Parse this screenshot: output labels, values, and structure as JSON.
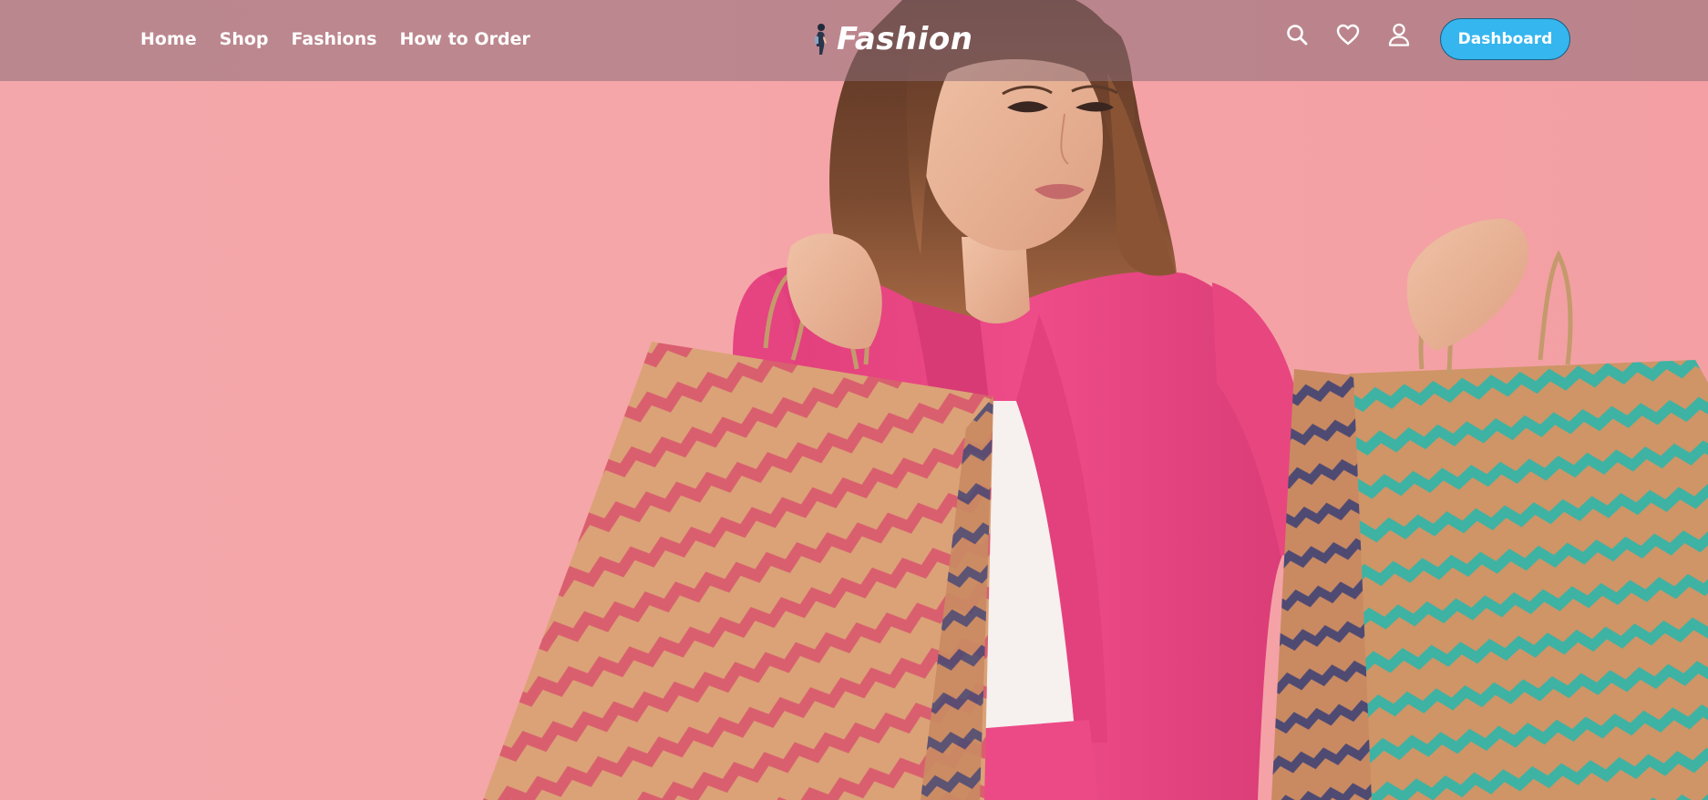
{
  "navbar": {
    "links": [
      {
        "label": "Home"
      },
      {
        "label": "Shop"
      },
      {
        "label": "Fashions"
      },
      {
        "label": "How to Order"
      }
    ],
    "brand": {
      "name": "Fashion",
      "logo_icon": "woman-silhouette-icon"
    },
    "icons": [
      "search-icon",
      "heart-icon",
      "user-icon"
    ],
    "dashboard_label": "Dashboard"
  },
  "hero": {
    "image": "woman-holding-shopping-bags-photo"
  },
  "colors": {
    "navbar_overlay": "#8c6e78",
    "accent_button": "#35b6ee",
    "hero_background": "#f4a5a8",
    "jacket": "#ec4a84",
    "bag_left_stripe": "#d9606f",
    "bag_right_stripe": "#3fb1a3",
    "kraft_paper": "#d9a57a"
  }
}
